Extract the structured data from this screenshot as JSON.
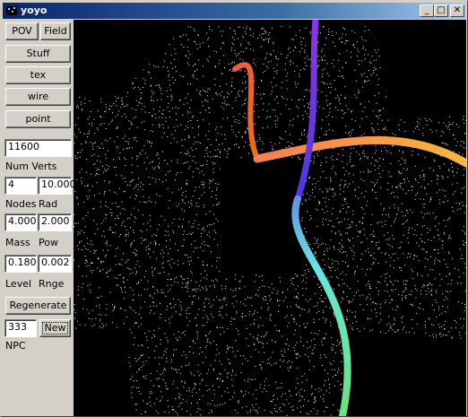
{
  "window": {
    "title": "yoyo",
    "minimize_glyph": "_",
    "maximize_glyph": "□",
    "close_glyph": "✕"
  },
  "buttons": {
    "pov": "POV",
    "field": "Field",
    "stuff": "Stuff",
    "tex": "tex",
    "wire": "wire",
    "point": "point",
    "regenerate": "Regenerate",
    "new": "New"
  },
  "fields": {
    "num_verts": "11600",
    "nodes": "4",
    "rad": "10.000",
    "mass": "4.000",
    "pow": "2.000",
    "level": "0.180",
    "rnge": "0.002",
    "npc": "333"
  },
  "labels": {
    "num_verts": "Num Verts",
    "nodes": "Nodes",
    "rad": "Rad",
    "mass": "Mass",
    "pow": "Pow",
    "level": "Level",
    "rnge": "Rnge",
    "npc": "NPC"
  },
  "scene": {
    "background": "#000000",
    "points_color": "#ffffff"
  }
}
